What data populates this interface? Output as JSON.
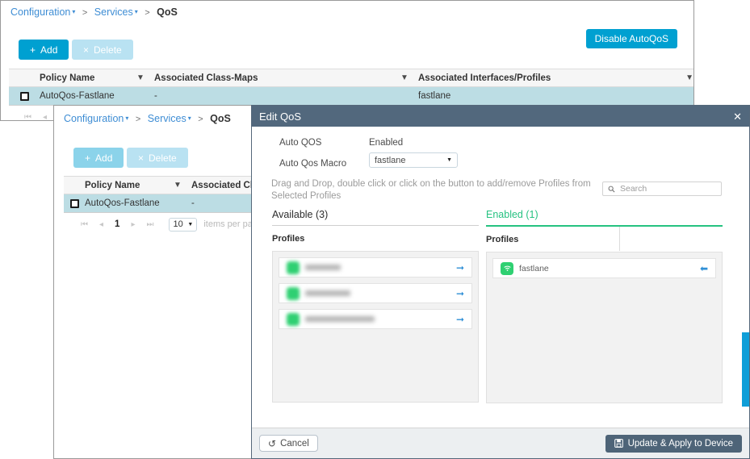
{
  "colors": {
    "accent_blue": "#00a0d1",
    "dialog_header": "#52687d",
    "row_selected": "#bcdde4",
    "enabled_green": "#26c281",
    "toggle_green": "#2fd072",
    "link_blue": "#3e8dd4"
  },
  "window_back": {
    "breadcrumb": {
      "item1": "Configuration",
      "item2": "Services",
      "current": "QoS",
      "separator": ">",
      "caret": "▾"
    },
    "toolbar": {
      "add_label": "Add",
      "add_plus": "+",
      "delete_label": "Delete",
      "delete_x": "×",
      "disable_autoqos_label": "Disable AutoQoS"
    },
    "table": {
      "columns": [
        "Policy Name",
        "Associated Class-Maps",
        "Associated Interfaces/Profiles"
      ],
      "filter_icon": "▼",
      "rows": [
        {
          "checked": false,
          "policy_name": "AutoQos-Fastlane",
          "class_maps": "-",
          "interfaces_profiles": "fastlane"
        }
      ]
    },
    "pager": {
      "first": "⏮",
      "prev": "◂"
    }
  },
  "window_front": {
    "breadcrumb": {
      "item1": "Configuration",
      "item2": "Services",
      "current": "QoS",
      "separator": ">",
      "caret": "▾"
    },
    "toolbar": {
      "add_label": "Add",
      "add_plus": "+",
      "delete_label": "Delete",
      "delete_x": "×"
    },
    "table": {
      "columns": [
        "Policy Name",
        "Associated Cl"
      ],
      "filter_icon": "▼",
      "rows": [
        {
          "checked": false,
          "policy_name": "AutoQos-Fastlane",
          "class_maps": "-"
        }
      ]
    },
    "pager": {
      "first": "⏮",
      "prev": "◂",
      "page": "1",
      "next": "▸",
      "last": "⏭",
      "items_per_page_value": "10",
      "items_per_page_caret": "▼",
      "items_per_page_label": "items per pag"
    }
  },
  "dialog": {
    "title": "Edit QoS",
    "close": "✕",
    "fields": [
      {
        "label": "Auto QOS",
        "value": "Enabled"
      },
      {
        "label": "Auto Qos Macro",
        "value": "fastlane",
        "caret": "▼"
      }
    ],
    "hint": "Drag and Drop, double click or click on the button to add/remove Profiles from Selected Profiles",
    "search": {
      "placeholder": "Search",
      "icon": "⚲"
    },
    "available": {
      "title": "Available (3)",
      "column_header": "Profiles",
      "items": [
        {
          "name": "",
          "redacted": true,
          "action": "➔"
        },
        {
          "name": "",
          "redacted": true,
          "action": "➔"
        },
        {
          "name": "",
          "redacted": true,
          "action": "➔"
        }
      ]
    },
    "enabled": {
      "title": "Enabled (1)",
      "column_header": "Profiles",
      "items": [
        {
          "name": "fastlane",
          "redacted": false,
          "action": "➔"
        }
      ]
    },
    "footer": {
      "cancel_label": "Cancel",
      "cancel_icon": "↺",
      "apply_label": "Update & Apply to Device",
      "apply_icon": "💾"
    }
  }
}
